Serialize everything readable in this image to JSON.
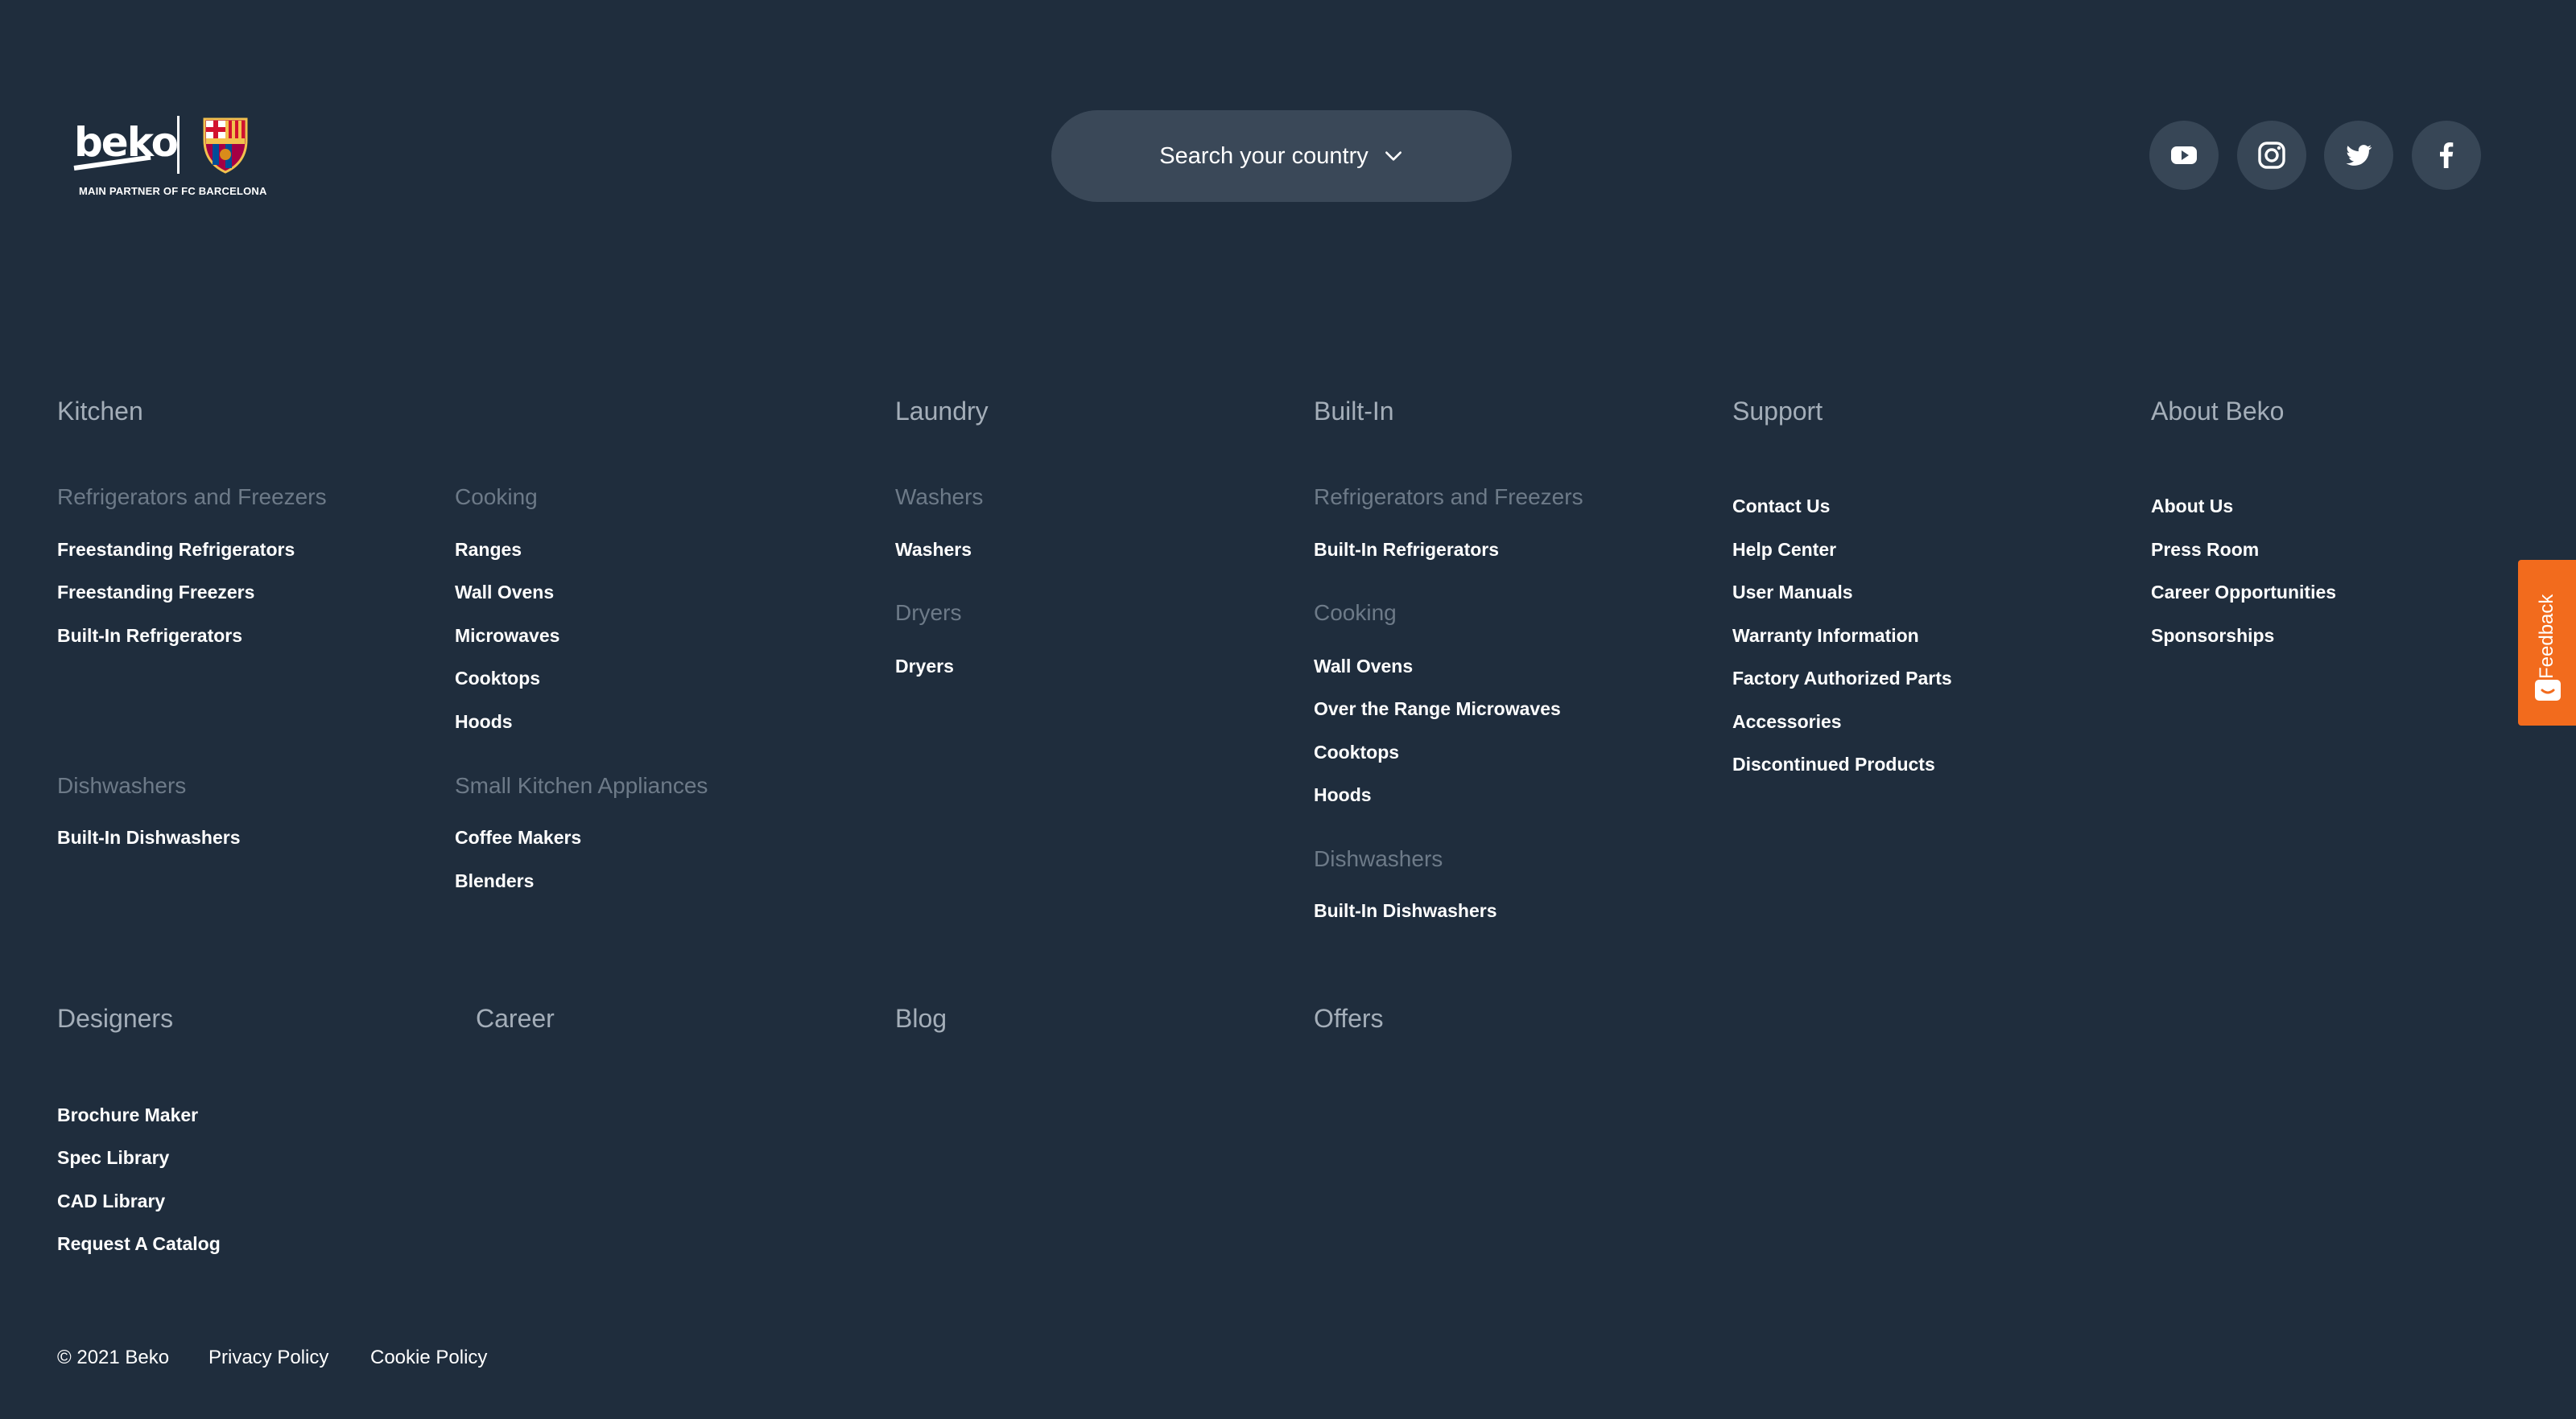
{
  "logo": {
    "brand": "beko",
    "partner_text": "MAIN PARTNER OF FC BARCELONA"
  },
  "country_search": {
    "label": "Search your country"
  },
  "social": [
    {
      "icon": "youtube-icon"
    },
    {
      "icon": "instagram-icon"
    },
    {
      "icon": "twitter-icon"
    },
    {
      "icon": "facebook-icon"
    }
  ],
  "kitchen": {
    "title": "Kitchen",
    "refrigerators": {
      "heading": "Refrigerators and Freezers",
      "links": [
        "Freestanding Refrigerators",
        "Freestanding Freezers",
        "Built-In Refrigerators"
      ]
    },
    "cooking": {
      "heading": "Cooking",
      "links": [
        "Ranges",
        "Wall Ovens",
        "Microwaves",
        "Cooktops",
        "Hoods"
      ]
    },
    "dishwashers": {
      "heading": "Dishwashers",
      "links": [
        "Built-In Dishwashers"
      ]
    },
    "small_appliances": {
      "heading": "Small Kitchen Appliances",
      "links": [
        "Coffee Makers",
        "Blenders"
      ]
    }
  },
  "laundry": {
    "title": "Laundry",
    "washers": {
      "heading": "Washers",
      "links": [
        "Washers"
      ]
    },
    "dryers": {
      "heading": "Dryers",
      "links": [
        "Dryers"
      ]
    }
  },
  "builtin": {
    "title": "Built-In",
    "refrigerators": {
      "heading": "Refrigerators and Freezers",
      "links": [
        "Built-In Refrigerators"
      ]
    },
    "cooking": {
      "heading": "Cooking",
      "links": [
        "Wall Ovens",
        "Over the Range Microwaves",
        "Cooktops",
        "Hoods"
      ]
    },
    "dishwashers": {
      "heading": "Dishwashers",
      "links": [
        "Built-In Dishwashers"
      ]
    }
  },
  "support": {
    "title": "Support",
    "links": [
      "Contact Us",
      "Help Center",
      "User Manuals",
      "Warranty Information",
      "Factory Authorized Parts",
      "Accessories",
      "Discontinued Products"
    ]
  },
  "about": {
    "title": "About Beko",
    "links": [
      "About Us",
      "Press Room",
      "Career Opportunities",
      "Sponsorships"
    ]
  },
  "designers": {
    "title": "Designers",
    "links": [
      "Brochure Maker",
      "Spec Library",
      "CAD Library",
      "Request A Catalog"
    ]
  },
  "career": {
    "title": "Career"
  },
  "blog": {
    "title": "Blog"
  },
  "offers": {
    "title": "Offers"
  },
  "feedback": {
    "label": "Feedback"
  },
  "legal": {
    "copyright": "© 2021 Beko",
    "privacy": "Privacy Policy",
    "cookie": "Cookie Policy"
  },
  "colors": {
    "background": "#1f2d3d",
    "feedback_tab": "#f26b1d"
  }
}
